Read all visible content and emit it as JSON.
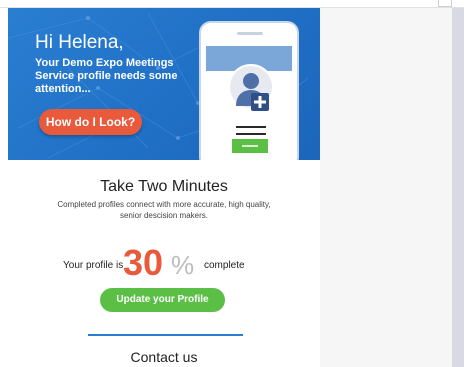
{
  "hero": {
    "greeting": "Hi Helena,",
    "message": "Your Demo Expo Meetings Service profile needs some attention...",
    "look_button": "How do I Look?",
    "bg_color": "#1f6fc5"
  },
  "intro": {
    "title": "Take Two Minutes",
    "subtitle": "Completed profiles connect with more accurate, high quality, senior descision makers."
  },
  "progress": {
    "prefix": "Your profile is",
    "value": "30",
    "percent_sign": "%",
    "suffix": "complete",
    "accent": "#e85a3b"
  },
  "update_button": "Update your Profile",
  "contact": {
    "title": "Contact us"
  }
}
